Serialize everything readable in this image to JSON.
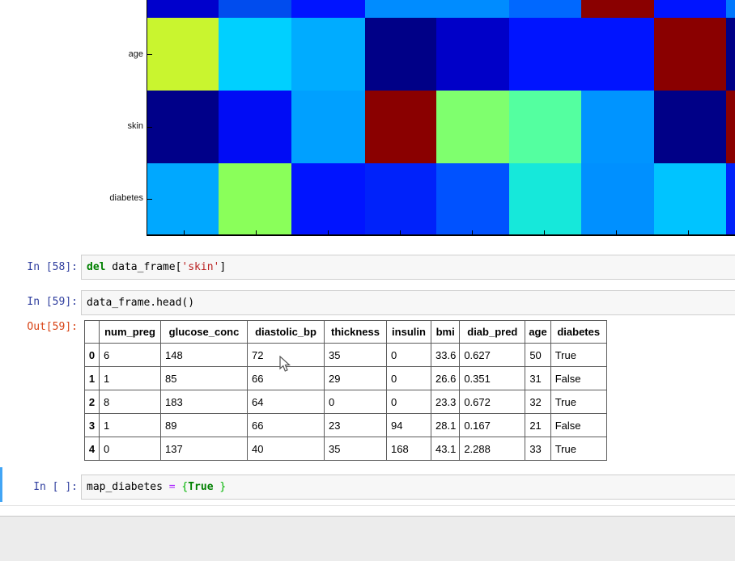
{
  "heatmap": {
    "y_labels": [
      "age",
      "skin",
      "diabetes"
    ],
    "rows": [
      {
        "name": "partial-top",
        "colors": [
          "#0000cc",
          "#004cee",
          "#0014ff",
          "#008cff",
          "#008cff",
          "#0068ff",
          "#8a0000",
          "#0014ff",
          "#0078ff"
        ]
      },
      {
        "name": "age",
        "colors": [
          "#c9f52f",
          "#00d0ff",
          "#00acff",
          "#000087",
          "#0000c8",
          "#0014ff",
          "#0014ff",
          "#8a0000",
          "#000087"
        ]
      },
      {
        "name": "skin",
        "colors": [
          "#000089",
          "#000cf5",
          "#00a0ff",
          "#8a0000",
          "#7fff6e",
          "#54ffa0",
          "#0094ff",
          "#000087",
          "#8a0000"
        ]
      },
      {
        "name": "diabetes",
        "colors": [
          "#00a8ff",
          "#8aff5a",
          "#0014ff",
          "#0022fa",
          "#0052ff",
          "#16e8da",
          "#0090ff",
          "#00c4ff",
          "#0022fa"
        ]
      }
    ]
  },
  "cells": {
    "in58": {
      "prompt": "In [58]:",
      "tokens": [
        [
          "kw",
          "del"
        ],
        [
          "pl",
          " data_frame["
        ],
        [
          "str",
          "'skin'"
        ],
        [
          "pl",
          "]"
        ]
      ]
    },
    "in59": {
      "prompt": "In [59]:",
      "tokens": [
        [
          "pl",
          "data_frame.head()"
        ]
      ]
    },
    "out59": {
      "prompt": "Out[59]:"
    },
    "in_empty": {
      "prompt": "In [ ]:",
      "tokens": [
        [
          "pl",
          "map_diabetes "
        ],
        [
          "op",
          "="
        ],
        [
          "pl",
          " "
        ],
        [
          "brk",
          "{"
        ],
        [
          "kw",
          "True"
        ],
        [
          "pl",
          " "
        ],
        [
          "brk",
          "}"
        ]
      ]
    }
  },
  "table": {
    "columns": [
      "",
      "num_preg",
      "glucose_conc",
      "diastolic_bp",
      "thickness",
      "insulin",
      "bmi",
      "diab_pred",
      "age",
      "diabetes"
    ],
    "rows": [
      [
        "0",
        "6",
        "148",
        "72",
        "35",
        "0",
        "33.6",
        "0.627",
        "50",
        "True"
      ],
      [
        "1",
        "1",
        "85",
        "66",
        "29",
        "0",
        "26.6",
        "0.351",
        "31",
        "False"
      ],
      [
        "2",
        "8",
        "183",
        "64",
        "0",
        "0",
        "23.3",
        "0.672",
        "32",
        "True"
      ],
      [
        "3",
        "1",
        "89",
        "66",
        "23",
        "94",
        "28.1",
        "0.167",
        "21",
        "False"
      ],
      [
        "4",
        "0",
        "137",
        "40",
        "35",
        "168",
        "43.1",
        "2.288",
        "33",
        "True"
      ]
    ]
  },
  "colors": {
    "prompt_in": "#303f9f",
    "prompt_out": "#d84315",
    "selected_cell_bar": "#42a5f5",
    "code_keyword": "#008000",
    "code_string": "#ba2121",
    "code_operator": "#aa22ff",
    "code_bracket_match": "#00b400",
    "axis": "#000000",
    "footer_bg": "#ececec"
  }
}
